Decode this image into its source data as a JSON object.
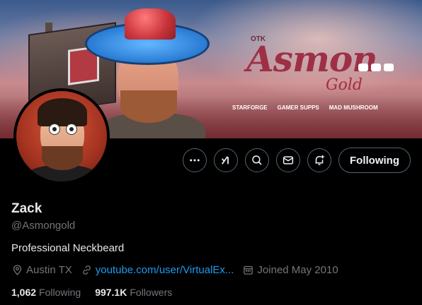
{
  "banner": {
    "logo_main": "Asmon",
    "logo_sub": "Gold",
    "otk": "OTK",
    "sponsors": [
      "STARFORGE",
      "GAMER SUPPS",
      "MAD MUSHROOM"
    ]
  },
  "actions": {
    "more_icon": "ellipsis-icon",
    "grok_icon": "grok-icon",
    "search_icon": "search-icon",
    "message_icon": "envelope-icon",
    "notify_icon": "bell-plus-icon",
    "follow_label": "Following"
  },
  "profile": {
    "name": "Zack",
    "handle": "@Asmongold",
    "bio": "Professional Neckbeard",
    "location": "Austin TX",
    "website": "youtube.com/user/VirtualEx...",
    "joined": "Joined May 2010"
  },
  "stats": {
    "following_count": "1,062",
    "following_label": "Following",
    "followers_count": "997.1K",
    "followers_label": "Followers"
  },
  "colors": {
    "background": "#000000",
    "text_primary": "#e7e9ea",
    "text_secondary": "#71767b",
    "link": "#1d9bf0",
    "border": "#536471"
  }
}
